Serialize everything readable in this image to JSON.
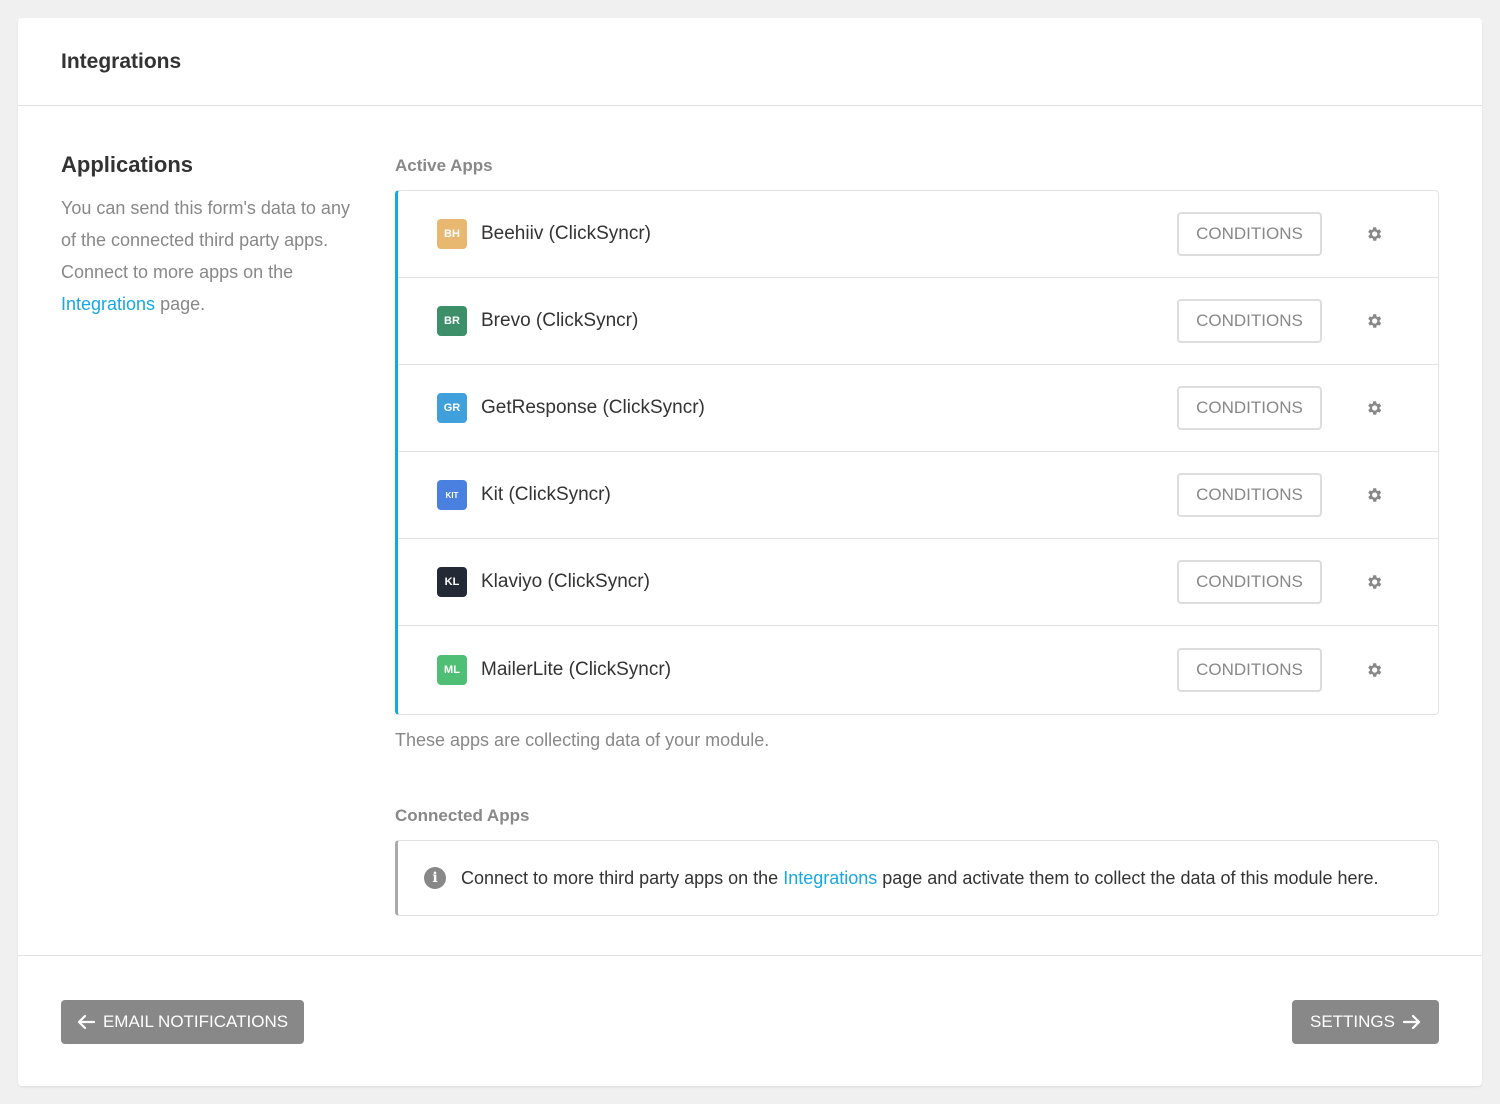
{
  "header": {
    "title": "Integrations"
  },
  "applications": {
    "title": "Applications",
    "desc_1": "You can send this form's data to any of the connected third party apps. Connect to more apps on the",
    "link": "Integrations",
    "desc_2": " page."
  },
  "active_apps": {
    "label": "Active Apps",
    "items": [
      {
        "badge": "BH",
        "name": "Beehiiv (ClickSyncr)",
        "color": "#e8b870",
        "conditions": "CONDITIONS"
      },
      {
        "badge": "BR",
        "name": "Brevo (ClickSyncr)",
        "color": "#3d8f6a",
        "conditions": "CONDITIONS"
      },
      {
        "badge": "GR",
        "name": "GetResponse (ClickSyncr)",
        "color": "#3fa0dc",
        "conditions": "CONDITIONS"
      },
      {
        "badge": "KIT",
        "name": "Kit (ClickSyncr)",
        "color": "#4a80e0",
        "conditions": "CONDITIONS"
      },
      {
        "badge": "KL",
        "name": "Klaviyo (ClickSyncr)",
        "color": "#232a36",
        "conditions": "CONDITIONS"
      },
      {
        "badge": "ML",
        "name": "MailerLite (ClickSyncr)",
        "color": "#4fbf76",
        "conditions": "CONDITIONS"
      }
    ],
    "caption": "These apps are collecting data of your module."
  },
  "connected_apps": {
    "label": "Connected Apps",
    "text_1": "Connect to more third party apps on the ",
    "link": "Integrations",
    "text_2": " page and activate them to collect the data of this module here."
  },
  "footer": {
    "prev_label": "EMAIL NOTIFICATIONS",
    "next_label": "SETTINGS"
  },
  "colors": {
    "accent": "#17a8e3",
    "button_gray": "#888888"
  }
}
